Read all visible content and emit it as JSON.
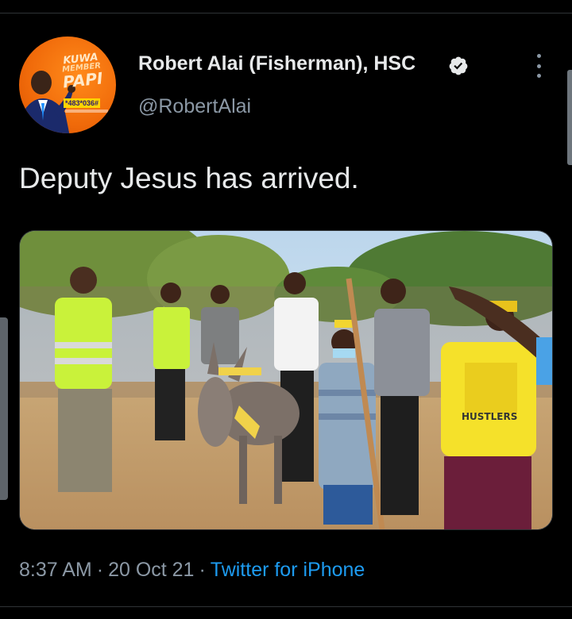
{
  "tweet": {
    "author": {
      "display_name": "Robert Alai (Fisherman), HSC",
      "handle": "@RobertAlai",
      "verified_icon": "verified-badge-icon",
      "avatar_text": {
        "line1": "KUWA",
        "line2": "MEMBER",
        "line3": "PAPI",
        "number": "*483*036#"
      }
    },
    "more_icon": "more-vertical-icon",
    "text": "Deputy Jesus has arrived.",
    "media": {
      "shirt_text": "HUSTLERS"
    },
    "meta": {
      "time": "8:37 AM",
      "date": "20 Oct 21",
      "separator": "·",
      "source": "Twitter for iPhone"
    }
  },
  "colors": {
    "background": "#000000",
    "text_primary": "#e7e9ea",
    "text_secondary": "#8b98a5",
    "link": "#1d9bf0",
    "divider": "#2f3336",
    "avatar_orange": "#f06a0a"
  }
}
